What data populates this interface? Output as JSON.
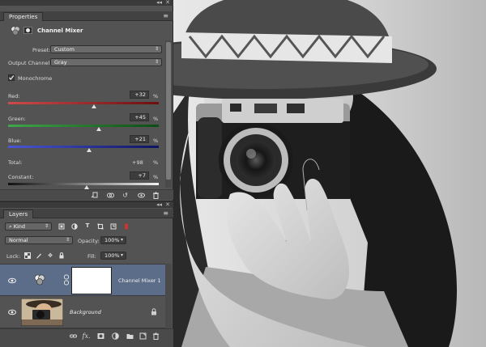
{
  "properties": {
    "tab": "Properties",
    "title": "Channel Mixer",
    "preset_label": "Preset:",
    "preset_value": "Custom",
    "output_channel_label": "Output Channel:",
    "output_channel_value": "Gray",
    "monochrome_label": "Monochrome",
    "monochrome_checked": true,
    "sliders": [
      {
        "label": "Red:",
        "value": "+32",
        "unit": "%",
        "fraction": 0.57
      },
      {
        "label": "Green:",
        "value": "+45",
        "unit": "%",
        "fraction": 0.6
      },
      {
        "label": "Blue:",
        "value": "+21",
        "unit": "%",
        "fraction": 0.54
      }
    ],
    "total_label": "Total:",
    "total_value": "+98",
    "total_unit": "%",
    "constant_label": "Constant:",
    "constant_value": "+7",
    "constant_unit": "%",
    "constant_fraction": 0.52
  },
  "layers": {
    "tab": "Layers",
    "filter_kind": "Kind",
    "blend_mode": "Normal",
    "opacity_label": "Opacity:",
    "opacity_value": "100%",
    "lock_label": "Lock:",
    "fill_label": "Fill:",
    "fill_value": "100%",
    "items": [
      {
        "name": "Channel Mixer 1",
        "selected": true
      },
      {
        "name": "Background",
        "selected": false,
        "locked": true
      }
    ]
  },
  "colors": {
    "panel_bg": "#535353",
    "selected_row": "#5b6d88",
    "red_track": "#b01f1f",
    "green_track": "#1f8f2a",
    "blue_track": "#2a37b8"
  }
}
